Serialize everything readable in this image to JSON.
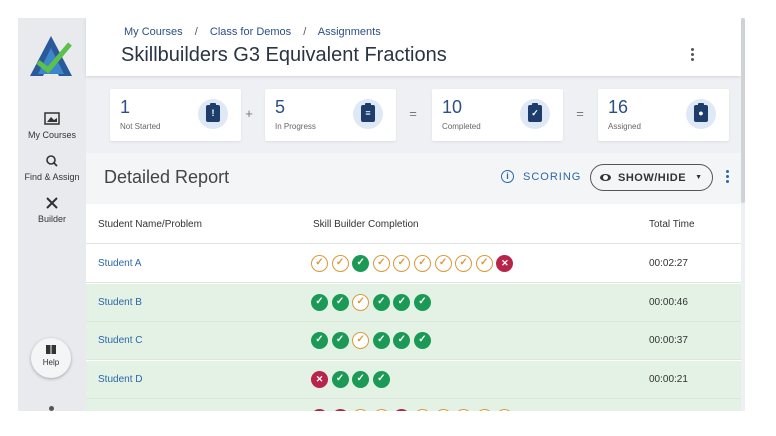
{
  "breadcrumb": {
    "item1": "My Courses",
    "item2": "Class for Demos",
    "item3": "Assignments",
    "sep": "/"
  },
  "page_title": "Skillbuilders G3 Equivalent Fractions",
  "sidebar": {
    "my_courses": "My Courses",
    "find_assign": "Find & Assign",
    "builder": "Builder",
    "help": "Help"
  },
  "stats": [
    {
      "value": "1",
      "label": "Not Started",
      "icon": "!"
    },
    {
      "value": "5",
      "label": "In Progress",
      "icon": "≡"
    },
    {
      "value": "10",
      "label": "Completed",
      "icon": "✓"
    },
    {
      "value": "16",
      "label": "Assigned",
      "icon": "●"
    }
  ],
  "operators": [
    "+",
    "=",
    "="
  ],
  "report": {
    "title": "Detailed Report",
    "scoring": "SCORING",
    "show_hide": "SHOW/HIDE",
    "columns": [
      "Student Name/Problem",
      "Skill Builder Completion",
      "Total Time"
    ]
  },
  "students": [
    {
      "name": "Student A",
      "time": "00:02:27",
      "marks": [
        "pend",
        "pend",
        "ok",
        "pend",
        "pend",
        "pend",
        "pend",
        "pend",
        "pend",
        "no"
      ]
    },
    {
      "name": "Student B",
      "time": "00:00:46",
      "marks": [
        "ok",
        "ok",
        "pend",
        "ok",
        "ok",
        "ok"
      ]
    },
    {
      "name": "Student C",
      "time": "00:00:37",
      "marks": [
        "ok",
        "ok",
        "pend",
        "ok",
        "ok",
        "ok"
      ]
    },
    {
      "name": "Student D",
      "time": "00:00:21",
      "marks": [
        "no",
        "ok",
        "ok",
        "ok"
      ]
    },
    {
      "name": "",
      "time": "",
      "marks": [
        "no",
        "no",
        "pend",
        "pend",
        "no",
        "pend",
        "pend",
        "pend",
        "pend",
        "pend"
      ]
    }
  ],
  "colors": {
    "ok": "#1a9a55",
    "pending": "#d99a3a",
    "wrong": "#b8254a",
    "link": "#2b67a8",
    "row_complete": "#e3f2e5"
  }
}
